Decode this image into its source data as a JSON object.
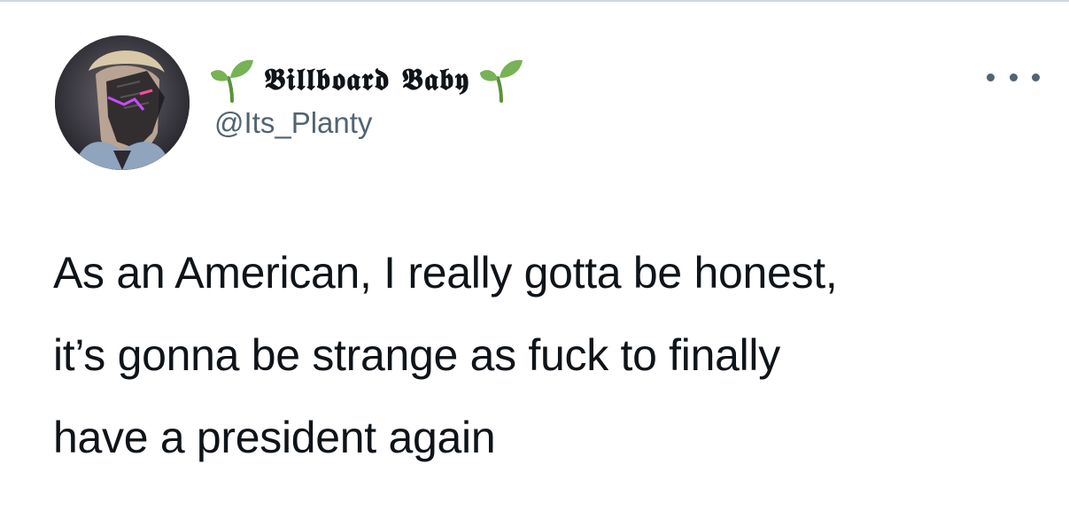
{
  "tweet": {
    "author": {
      "display_name": "𝕭𝖎𝖑𝖑𝖇𝖔𝖆𝖗𝖉 𝕭𝖆𝖇𝖞",
      "handle": "@Its_Planty",
      "name_icon": "seedling-icon",
      "avatar_icon": "profile-photo"
    },
    "more_icon": "more-horizontal-icon",
    "text_lines": [
      "As an American, I really gotta be honest,",
      "it’s gonna be strange as fuck to finally",
      "have a president again"
    ]
  },
  "colors": {
    "text": "#0f1419",
    "secondary": "#536471",
    "border": "#cfd9de",
    "sprout": "#77b255"
  }
}
